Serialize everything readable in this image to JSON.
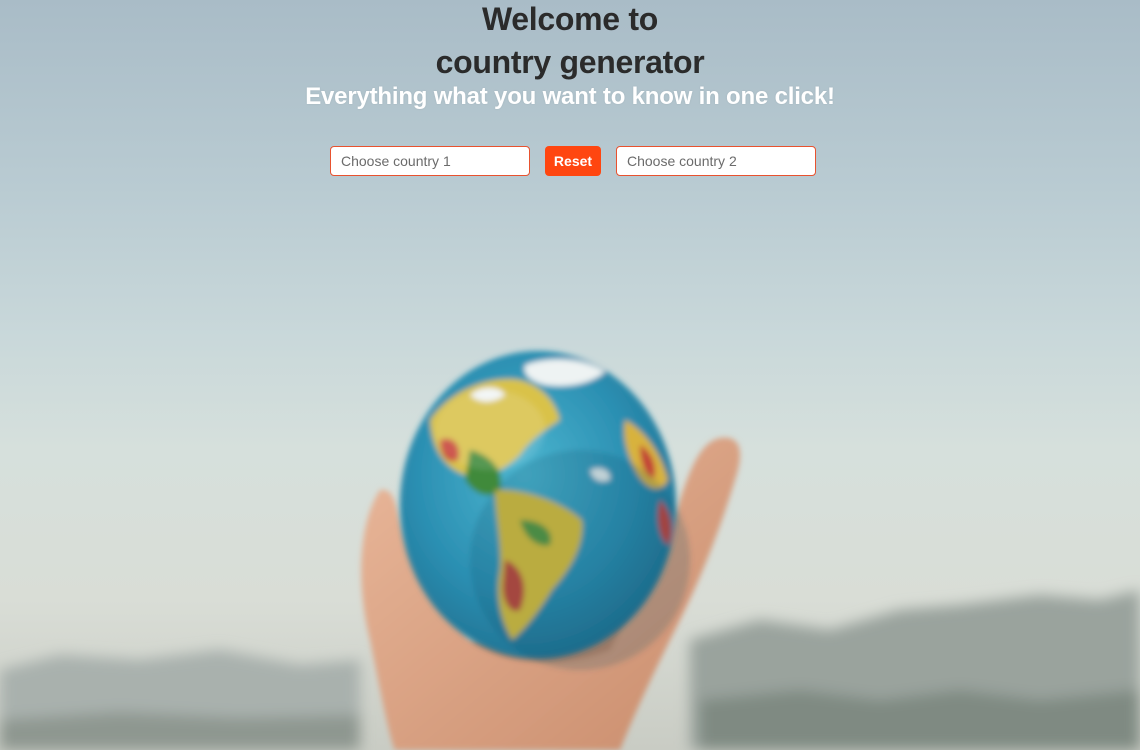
{
  "header": {
    "title_line1": "Welcome to",
    "title_line2": "country generator",
    "subtitle": "Everything what you want to know in one click!"
  },
  "controls": {
    "country1_placeholder": "Choose country 1",
    "country1_value": "",
    "reset_label": "Reset",
    "country2_placeholder": "Choose country 2",
    "country2_value": ""
  },
  "background": {
    "image": "hand-holding-globe-photo"
  },
  "colors": {
    "accent": "#ff4610",
    "input_border": "#e8522f",
    "title": "#2b2b2b",
    "subtitle": "#ffffff"
  }
}
